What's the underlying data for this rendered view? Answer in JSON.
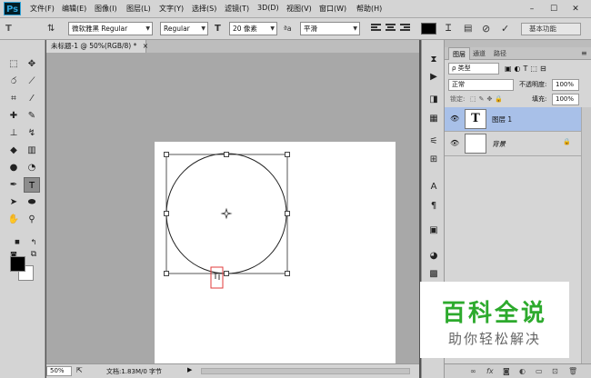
{
  "app": {
    "logo": "Ps"
  },
  "menu": [
    "文件(F)",
    "编辑(E)",
    "图像(I)",
    "图层(L)",
    "文字(Y)",
    "选择(S)",
    "滤镜(T)",
    "3D(D)",
    "视图(V)",
    "窗口(W)",
    "帮助(H)"
  ],
  "window_controls": {
    "minimize": "–",
    "maximize": "☐",
    "close": "✕"
  },
  "options": {
    "font_family": "微软雅黑 Regular",
    "font_style": "Regular",
    "font_size": "20 像素",
    "aa_icon": "ªa",
    "anti_alias": "平滑",
    "text_color": "#000000",
    "workspace": "基本功能"
  },
  "document": {
    "tab_title": "未标题-1 @ 50%(RGB/8) *",
    "tab_close": "×",
    "zoom": "50%",
    "info": "文档:1.83M/0 字节"
  },
  "layers_panel": {
    "tabs": [
      "图层",
      "通道",
      "路径"
    ],
    "filter_kind": "ρ 类型",
    "blend_mode": "正常",
    "opacity_label": "不透明度:",
    "opacity_value": "100%",
    "lock_label": "锁定:",
    "fill_label": "填充:",
    "fill_value": "100%",
    "layers": [
      {
        "name": "图层 1",
        "thumb": "T",
        "selected": true
      },
      {
        "name": "背景",
        "thumb": "",
        "selected": false
      }
    ],
    "footer_icons": [
      "link-icon",
      "fx-icon",
      "mask-icon",
      "adjustment-icon",
      "group-icon",
      "new-layer-icon",
      "trash-icon"
    ]
  },
  "watermark": {
    "title": "百科全说",
    "subtitle": "助你轻松解决"
  },
  "colors": {
    "foreground": "#000000",
    "background": "#ffffff",
    "watermark_green": "#2daa2d",
    "selected_layer": "#a8c0e8"
  }
}
